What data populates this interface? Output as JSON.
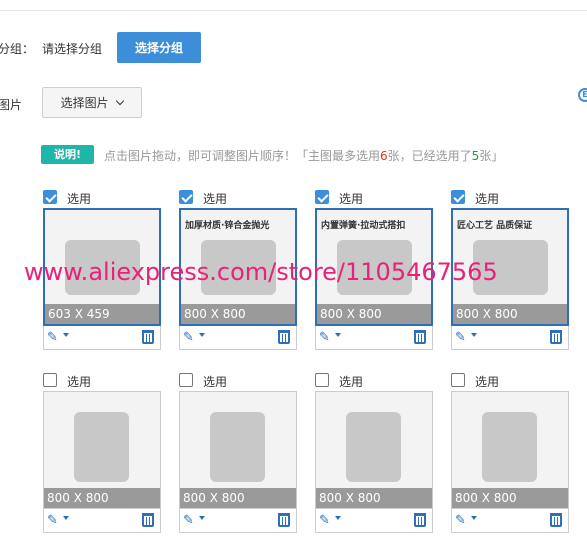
{
  "group": {
    "label": "分组：",
    "placeholder": "请选择分组",
    "button": "选择分组"
  },
  "images": {
    "label": "图片",
    "button": "选择图片"
  },
  "notice": {
    "badge": "说明!",
    "text_before": "点击图片拖动，即可调整图片顺序！「主图最多选用",
    "max": "6",
    "text_middle": "张，已经选用了",
    "selected": "5",
    "text_after": "张」"
  },
  "select_label": "选用",
  "cards": [
    {
      "checked": true,
      "size": "603 X 459",
      "caption": ""
    },
    {
      "checked": true,
      "size": "800 X 800",
      "caption": "加厚材质·锌合金抛光"
    },
    {
      "checked": true,
      "size": "800 X 800",
      "caption": "内置弹簧·拉动式搭扣"
    },
    {
      "checked": true,
      "size": "800 X 800",
      "caption": "匠心工艺 品质保证"
    },
    {
      "checked": false,
      "size": "800 X 800",
      "caption": ""
    },
    {
      "checked": false,
      "size": "800 X 800",
      "caption": ""
    },
    {
      "checked": false,
      "size": "800 X 800",
      "caption": ""
    },
    {
      "checked": false,
      "size": "800 X 800",
      "caption": ""
    }
  ],
  "watermark": "www.aliexpress.com/store/1105467565",
  "colors": {
    "primary": "#3d8ed9",
    "badge": "#1eb6a8",
    "watermark": "#e8217a",
    "max": "#e3341b",
    "selected": "#1d9b3d"
  }
}
